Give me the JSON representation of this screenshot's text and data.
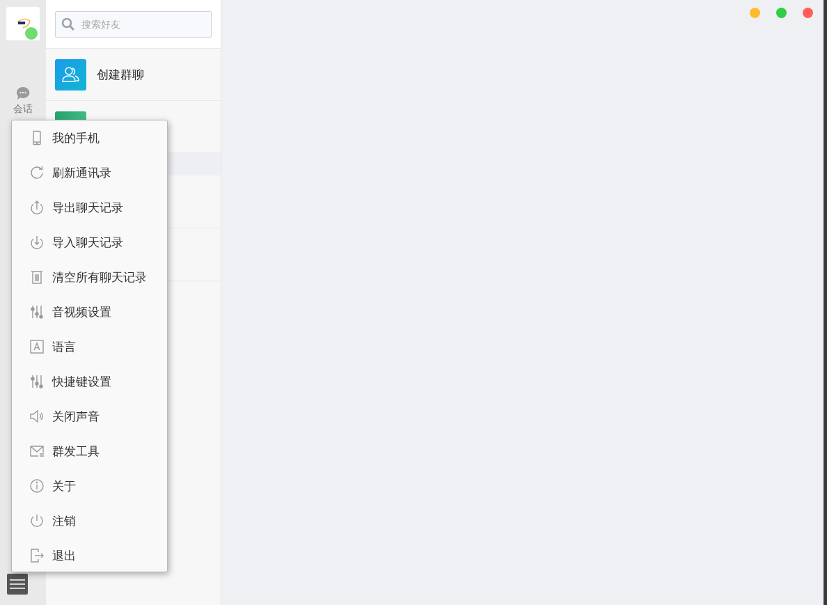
{
  "sidebar": {
    "nav": [
      {
        "label": "会话",
        "selected": false
      }
    ]
  },
  "search": {
    "placeholder": "搜索好友"
  },
  "list": [
    {
      "label": "创建群聊",
      "kind": "group"
    },
    {
      "kind": "green"
    }
  ],
  "menu": {
    "items": [
      {
        "label": "我的手机",
        "kind": "phone"
      },
      {
        "label": "刷新通讯录",
        "kind": "refresh"
      },
      {
        "label": "导出聊天记录",
        "kind": "export"
      },
      {
        "label": "导入聊天记录",
        "kind": "import"
      },
      {
        "label": "清空所有聊天记录",
        "kind": "trash"
      },
      {
        "label": "音视频设置",
        "kind": "sliders"
      },
      {
        "label": "语言",
        "kind": "language"
      },
      {
        "label": "快捷键设置",
        "kind": "sliders"
      },
      {
        "label": "关闭声音",
        "kind": "speaker"
      },
      {
        "label": "群发工具",
        "kind": "mail"
      },
      {
        "label": "关于",
        "kind": "info"
      },
      {
        "label": "注销",
        "kind": "power"
      },
      {
        "label": "退出",
        "kind": "exit"
      }
    ]
  },
  "window_controls": [
    {
      "color": "#fdbc2c"
    },
    {
      "color": "#2fce44"
    },
    {
      "color": "#ff5f57"
    }
  ]
}
